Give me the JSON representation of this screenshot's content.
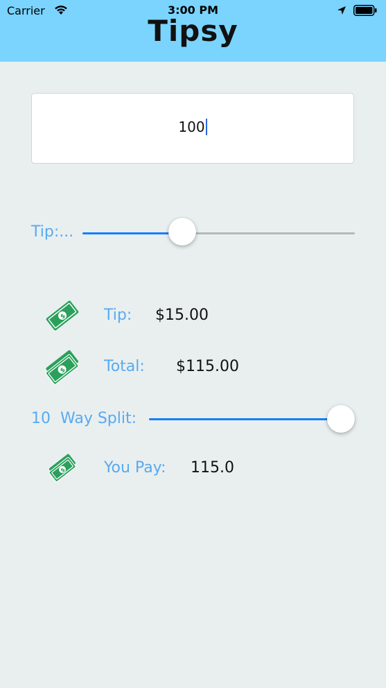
{
  "status_bar": {
    "carrier": "Carrier",
    "time": "3:00 PM",
    "wifi_icon": "wifi-icon",
    "location_icon": "location-arrow-icon",
    "battery_icon": "battery-icon"
  },
  "app": {
    "title": "Tipsy",
    "header_color": "#7ad4fe",
    "background_color": "#e9efef"
  },
  "bill_input": {
    "value": "100"
  },
  "tip_slider": {
    "label": "Tip:...",
    "value_fraction": 0.35,
    "accent": "#147efb"
  },
  "results": {
    "tip_label": "Tip:",
    "tip_value": "$15.00",
    "total_label": "Total:",
    "total_value": "$115.00",
    "icon": "money-bill-icon"
  },
  "split": {
    "count": "10",
    "label": "Way Split:",
    "value_fraction": 1.0
  },
  "you_pay": {
    "label": "You Pay:",
    "value": "115.0"
  },
  "colors": {
    "label_blue": "#58aaf0",
    "money_green": "#2aa05b"
  }
}
